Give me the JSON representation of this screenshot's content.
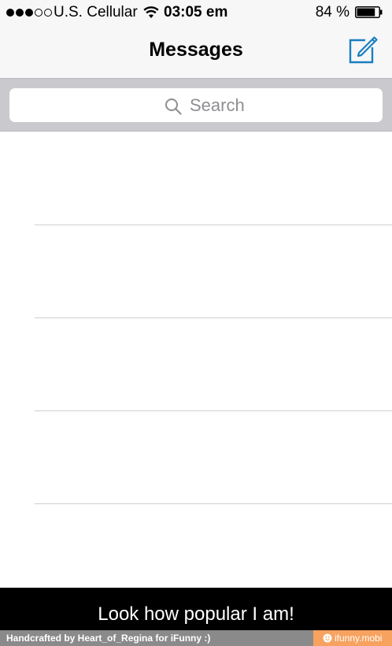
{
  "status_bar": {
    "signal_strength": 3,
    "signal_max": 5,
    "carrier": "U.S. Cellular",
    "wifi_icon": "wifi-icon",
    "time": "03:05 em",
    "battery_percent": "84 %",
    "battery_level": 0.84
  },
  "nav": {
    "title": "Messages",
    "compose_icon": "compose-icon"
  },
  "search": {
    "placeholder": "Search",
    "icon": "search-icon"
  },
  "conversations": [
    {
      "name": ""
    },
    {
      "name": ""
    },
    {
      "name": ""
    },
    {
      "name": ""
    },
    {
      "name": ""
    }
  ],
  "caption": "Look how popular I am!",
  "footer": {
    "credit": "Handcrafted by Heart_of_Regina for iFunny :)",
    "site": "ifunny.mobi",
    "site_icon": "smiley-icon"
  },
  "colors": {
    "accent": "#1a7fc1",
    "top_bg": "#f7f7f7",
    "search_bar_bg": "#c9c9ce",
    "caption_bg": "#000000",
    "footer_bg": "#8a8a8a",
    "badge_bg": "#f7a25f"
  }
}
